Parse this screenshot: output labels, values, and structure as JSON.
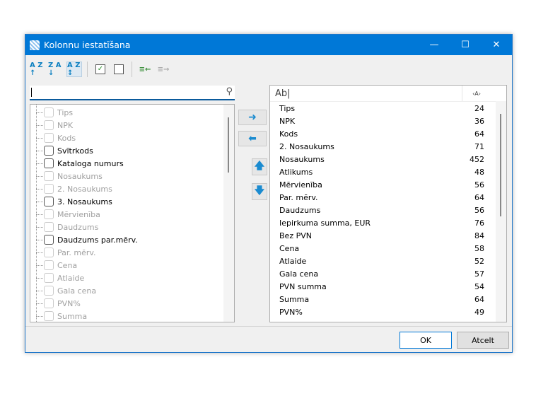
{
  "window": {
    "title": "Kolonnu iestatīšana",
    "minimize": "—",
    "maximize": "☐",
    "close": "✕"
  },
  "toolbar": {
    "sort_asc": "A Z ↑",
    "sort_desc": "Z A ↓",
    "sort_custom": "A Z ↕",
    "check_all": "✓",
    "uncheck_all": "",
    "add_selected": "≡←",
    "remove_selected": "≡→"
  },
  "search": {
    "value": ""
  },
  "left_list": [
    {
      "label": "Tips",
      "enabled": false
    },
    {
      "label": "NPK",
      "enabled": false
    },
    {
      "label": "Kods",
      "enabled": false
    },
    {
      "label": "Svītrkods",
      "enabled": true
    },
    {
      "label": "Kataloga numurs",
      "enabled": true
    },
    {
      "label": "Nosaukums",
      "enabled": false
    },
    {
      "label": "2. Nosaukums",
      "enabled": false
    },
    {
      "label": "3. Nosaukums",
      "enabled": true
    },
    {
      "label": "Mērvienība",
      "enabled": false
    },
    {
      "label": "Daudzums",
      "enabled": false
    },
    {
      "label": "Daudzums par.mērv.",
      "enabled": true
    },
    {
      "label": "Par. mērv.",
      "enabled": false
    },
    {
      "label": "Cena",
      "enabled": false
    },
    {
      "label": "Atlaide",
      "enabled": false
    },
    {
      "label": "Gala cena",
      "enabled": false
    },
    {
      "label": "PVN%",
      "enabled": false
    },
    {
      "label": "Summa",
      "enabled": false
    }
  ],
  "middle": {
    "add": "➜",
    "remove": "⬅",
    "up": "🡅",
    "down": "🡇"
  },
  "right_header": {
    "name": "Ab|",
    "width_icon": "‹A›"
  },
  "right_list": [
    {
      "name": "Tips",
      "width": "24"
    },
    {
      "name": "NPK",
      "width": "36"
    },
    {
      "name": "Kods",
      "width": "64"
    },
    {
      "name": "2. Nosaukums",
      "width": "71"
    },
    {
      "name": "Nosaukums",
      "width": "452"
    },
    {
      "name": "Atlikums",
      "width": "48"
    },
    {
      "name": "Mērvienība",
      "width": "56"
    },
    {
      "name": "Par. mērv.",
      "width": "64"
    },
    {
      "name": "Daudzums",
      "width": "56"
    },
    {
      "name": "Iepirkuma summa, EUR",
      "width": "76"
    },
    {
      "name": "Bez PVN",
      "width": "84"
    },
    {
      "name": "Cena",
      "width": "58"
    },
    {
      "name": "Atlaide",
      "width": "52"
    },
    {
      "name": "Gala cena",
      "width": "57"
    },
    {
      "name": "PVN summa",
      "width": "54"
    },
    {
      "name": "Summa",
      "width": "64"
    },
    {
      "name": "PVN%",
      "width": "49"
    }
  ],
  "buttons": {
    "ok": "OK",
    "cancel": "Atcelt"
  }
}
